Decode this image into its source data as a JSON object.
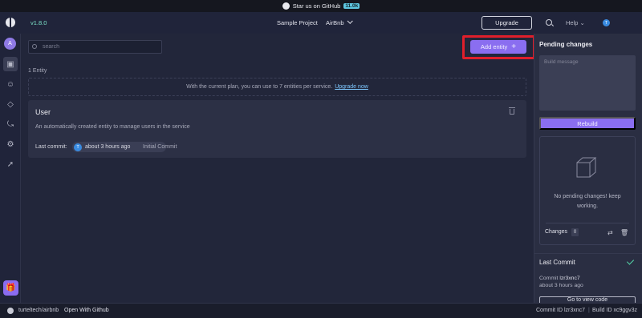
{
  "banner": {
    "text": "Star us on GitHub",
    "count": "11.0k"
  },
  "header": {
    "version": "v1.8.0",
    "project": "Sample Project",
    "repo": "AirBnb",
    "upgrade_label": "Upgrade",
    "help_label": "Help",
    "user_initial": "T"
  },
  "sidebar": {
    "avatar_initial": "A",
    "items": [
      {
        "icon": "database-icon",
        "active": true
      },
      {
        "icon": "roles-icon",
        "active": false
      },
      {
        "icon": "plugin-icon",
        "active": false
      },
      {
        "icon": "connections-icon",
        "active": false
      },
      {
        "icon": "settings-icon",
        "active": false
      },
      {
        "icon": "deploy-icon",
        "active": false
      }
    ],
    "gift_icon": "gift-icon"
  },
  "main": {
    "search_placeholder": "search",
    "add_entity_label": "Add entity",
    "entity_count": "1 Entity",
    "plan_text": "With the current plan, you can use to 7 entities per service.",
    "plan_link": "Upgrade now",
    "entities": [
      {
        "name": "User",
        "description": "An automatically created entity to manage users in the service",
        "last_commit_label": "Last commit:",
        "author_initial": "T",
        "time": "about 3 hours ago",
        "message": "Initial Commit"
      }
    ]
  },
  "right_panel": {
    "title": "Pending changes",
    "message_placeholder": "Build message",
    "rebuild_label": "Rebuild",
    "empty_text": "No pending changes! keep working.",
    "changes_label": "Changes",
    "changes_count": "0",
    "last_commit_title": "Last Commit",
    "commit_label": "Commit",
    "commit_id": "lzr3xnc7",
    "commit_time": "about 3 hours ago",
    "go_to_code_label": "Go to view code"
  },
  "footer": {
    "repo": "turteltech/airbnb",
    "open_github": "Open With Github",
    "commit_id": "Commit ID lzr3xnc7",
    "separator": "|",
    "build_id": "Build ID xc9ggv3z"
  },
  "colors": {
    "accent": "#8a6ef0",
    "highlight": "#e01f2b",
    "success": "#55d6a8",
    "link": "#7ec8ff"
  }
}
